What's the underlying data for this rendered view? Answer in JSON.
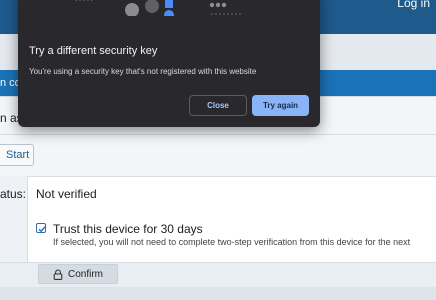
{
  "header": {
    "login_label": "Log in"
  },
  "band": {
    "clipped_text": "n co"
  },
  "form": {
    "row_label_clipped": "n as",
    "start_label": "Start",
    "status_label_clipped": "atus:",
    "status_value": "Not verified",
    "trust": {
      "checked": true,
      "label": "Trust this device for 30 days",
      "help": "If selected, you will not need to complete two-step verification from this device for the next"
    },
    "confirm_label": "Confirm"
  },
  "dialog": {
    "title": "Try a different security key",
    "message": "You're using a security key that's not registered with this website",
    "close_label": "Close",
    "retry_label": "Try again"
  },
  "colors": {
    "accent_blue": "#1a73b8",
    "dialog_bg": "#29292d",
    "dialog_primary": "#8ab4f8",
    "dialog_link": "#a6c8ff"
  },
  "icons": [
    "security-key-illustration",
    "checkbox-checked-icon",
    "lock-icon"
  ]
}
